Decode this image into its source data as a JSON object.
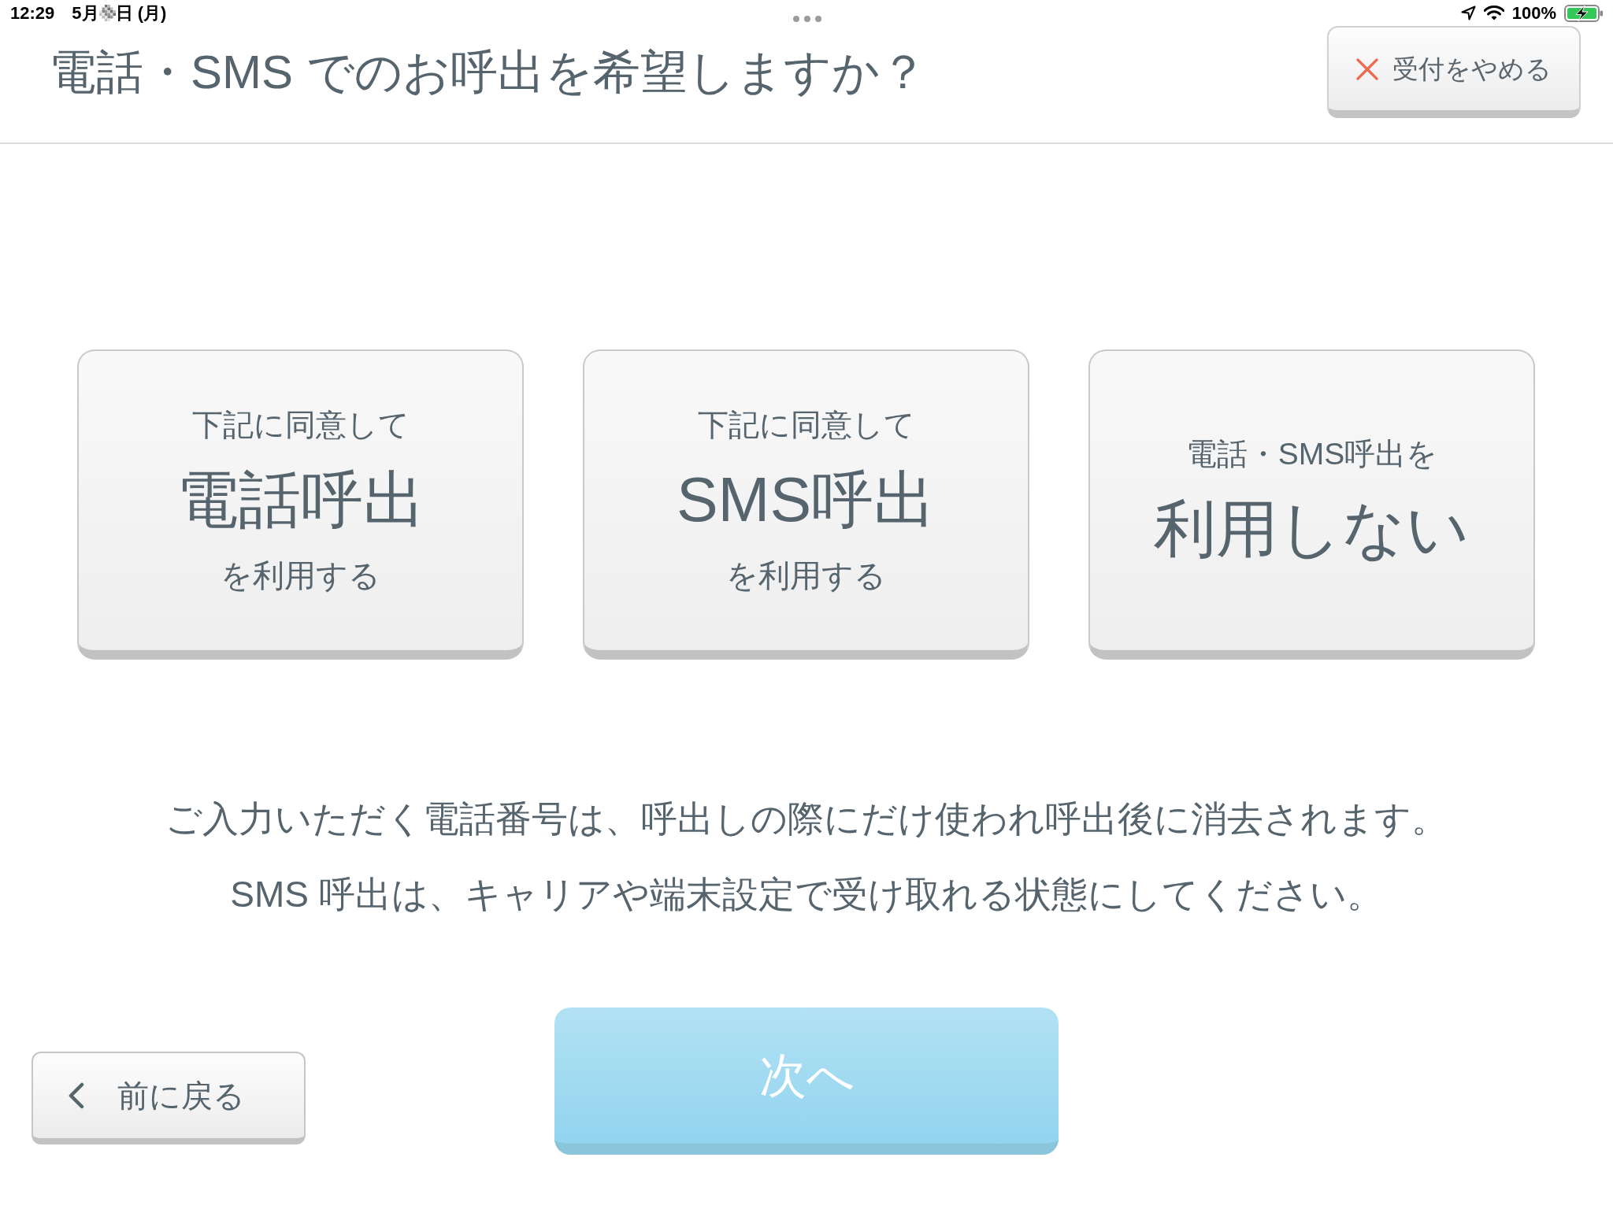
{
  "status_bar": {
    "time": "12:29",
    "date_month": "5月",
    "date_rest": "日 (月)",
    "battery": "100%"
  },
  "header": {
    "title": "電話・SMS でのお呼出を希望しますか？",
    "cancel_button": "受付をやめる"
  },
  "options": [
    {
      "above": "下記に同意して",
      "headline": "電話呼出",
      "below": "を利用する",
      "selected": false
    },
    {
      "above": "下記に同意して",
      "headline": "SMS呼出",
      "below": "を利用する",
      "selected": false
    },
    {
      "above": "電話・SMS呼出を",
      "headline": "利用しない",
      "selected": false
    }
  ],
  "notes": [
    "ご入力いただく電話番号は、呼出しの際にだけ使われ呼出後に消去されます。",
    "SMS 呼出は、キャリアや端末設定で受け取れる状態にしてください。"
  ],
  "back_button": "前に戻る",
  "next_button": {
    "label": "次へ",
    "disabled": true
  }
}
